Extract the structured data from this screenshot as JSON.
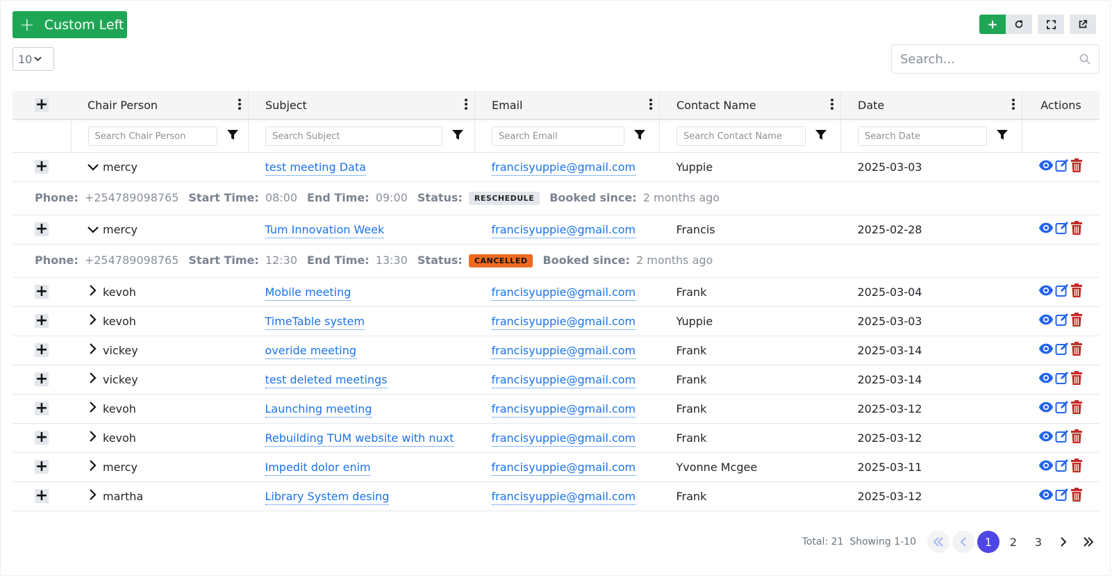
{
  "toolbar": {
    "custom_left_label": "Custom Left",
    "page_size": "10",
    "search_placeholder": "Search..."
  },
  "table": {
    "columns": [
      "Chair Person",
      "Subject",
      "Email",
      "Contact Name",
      "Date",
      "Actions"
    ],
    "filters": [
      "Search Chair Person",
      "Search Subject",
      "Search Email",
      "Search Contact Name",
      "Search Date"
    ],
    "rows": [
      {
        "chair": "mercy",
        "subject": "test meeting Data",
        "email": "francisyuppie@gmail.com",
        "contact": "Yuppie",
        "date": "2025-03-03",
        "expanded": true,
        "detail": {
          "phone_label": "Phone:",
          "phone": "+254789098765",
          "start_label": "Start Time:",
          "start": "08:00",
          "end_label": "End Time:",
          "end": "09:00",
          "status_label": "Status:",
          "status": "RESCHEDULE",
          "booked_label": "Booked since:",
          "booked": "2 months ago"
        }
      },
      {
        "chair": "mercy",
        "subject": "Tum Innovation Week",
        "email": "francisyuppie@gmail.com",
        "contact": "Francis",
        "date": "2025-02-28",
        "expanded": true,
        "detail": {
          "phone_label": "Phone:",
          "phone": "+254789098765",
          "start_label": "Start Time:",
          "start": "12:30",
          "end_label": "End Time:",
          "end": "13:30",
          "status_label": "Status:",
          "status": "CANCELLED",
          "booked_label": "Booked since:",
          "booked": "2 months ago"
        }
      },
      {
        "chair": "kevoh",
        "subject": "Mobile meeting",
        "email": "francisyuppie@gmail.com",
        "contact": "Frank",
        "date": "2025-03-04"
      },
      {
        "chair": "kevoh",
        "subject": "TimeTable system",
        "email": "francisyuppie@gmail.com",
        "contact": "Yuppie",
        "date": "2025-03-03"
      },
      {
        "chair": "vickey",
        "subject": "overide meeting",
        "email": "francisyuppie@gmail.com",
        "contact": "Frank",
        "date": "2025-03-14"
      },
      {
        "chair": "vickey",
        "subject": "test deleted meetings",
        "email": "francisyuppie@gmail.com",
        "contact": "Frank",
        "date": "2025-03-14"
      },
      {
        "chair": "kevoh",
        "subject": "Launching meeting",
        "email": "francisyuppie@gmail.com",
        "contact": "Frank",
        "date": "2025-03-12"
      },
      {
        "chair": "kevoh",
        "subject": "Rebuilding TUM website with nuxt",
        "email": "francisyuppie@gmail.com",
        "contact": "Frank",
        "date": "2025-03-12"
      },
      {
        "chair": "mercy",
        "subject": "Impedit dolor enim",
        "email": "francisyuppie@gmail.com",
        "contact": "Yvonne Mcgee",
        "date": "2025-03-11"
      },
      {
        "chair": "martha",
        "subject": "Library System desing",
        "email": "francisyuppie@gmail.com",
        "contact": "Frank",
        "date": "2025-03-12"
      }
    ]
  },
  "pagination": {
    "total_text": "Total: 21",
    "showing_text": "Showing 1-10",
    "pages": [
      "1",
      "2",
      "3"
    ],
    "current": "1"
  },
  "colors": {
    "primary_green": "#1fa655",
    "link_blue": "#1a73e8",
    "delete_red": "#c62828",
    "active_page": "#4f46e5",
    "cancelled_orange": "#ee6a1f"
  }
}
